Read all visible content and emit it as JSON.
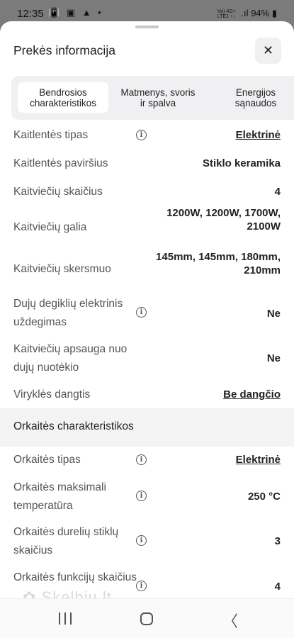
{
  "status_bar": {
    "time": "12:35",
    "left_icons": "📳 ▣ ▲ •",
    "network": "Vo) 4G+\nLTE1 ↑↓",
    "signal": ".ıl",
    "battery": "94%",
    "battery_icon": "▮"
  },
  "sheet": {
    "title": "Prekės informacija",
    "close_glyph": "✕"
  },
  "tabs": [
    {
      "label": "Bendrosios charakteristikos",
      "active": true
    },
    {
      "label": "Matmenys, svoris ir spalva",
      "active": false
    },
    {
      "label": "Energijos sąnaudos",
      "active": false
    }
  ],
  "rows": [
    {
      "label": "Kaitlentės tipas",
      "value": "Elektrinė",
      "info": true,
      "link": true
    },
    {
      "label": "Kaitlentės paviršius",
      "value": "Stiklo keramika",
      "info": false,
      "link": false
    },
    {
      "label": "Kaitviečių skaičius",
      "value": "4",
      "info": false,
      "link": false
    },
    {
      "label": "Kaitviečių galia",
      "value": "1200W, 1200W, 1700W, 2100W",
      "info": false,
      "link": false
    },
    {
      "label": "Kaitviečių skersmuo",
      "value": "145mm, 145mm, 180mm, 210mm",
      "info": false,
      "link": false
    },
    {
      "label": "Dujų degiklių elektrinis uždegimas",
      "value": "Ne",
      "info": true,
      "link": false
    },
    {
      "label": "Kaitviečių apsauga nuo dujų nuotėkio",
      "value": "Ne",
      "info": false,
      "link": false
    },
    {
      "label": "Viryklės dangtis",
      "value": "Be dangčio",
      "info": false,
      "link": true
    }
  ],
  "section_title": "Orkaitės charakteristikos",
  "rows2": [
    {
      "label": "Orkaitės tipas",
      "value": "Elektrinė",
      "info": true,
      "link": true
    },
    {
      "label": "Orkaitės maksimali temperatūra",
      "value": "250 °C",
      "info": true,
      "link": false
    },
    {
      "label": "Orkaitės durelių stiklų skaičius",
      "value": "3",
      "info": true,
      "link": false
    },
    {
      "label": "Orkaitės funkcijų skaičius",
      "value": "4",
      "info": true,
      "link": false
    }
  ],
  "info_glyph": "i",
  "watermark": "✿ Skelbiu.lt",
  "nav": {
    "back_glyph": "〈"
  }
}
